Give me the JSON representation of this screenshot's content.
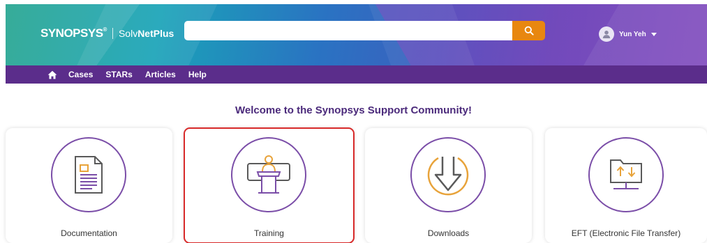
{
  "header": {
    "brand": "SYNOPSYS",
    "brand_mark": "®",
    "product_prefix": "Solv",
    "product_name": "NetPlus",
    "search": {
      "value": "",
      "placeholder": ""
    },
    "user": {
      "name": "Yun Yeh"
    }
  },
  "nav": {
    "items": [
      {
        "label": "Cases"
      },
      {
        "label": "STARs"
      },
      {
        "label": "Articles"
      },
      {
        "label": "Help"
      }
    ]
  },
  "main": {
    "welcome": "Welcome to the Synopsys Support Community!",
    "cards": [
      {
        "label": "Documentation",
        "icon": "document-icon",
        "selected": false
      },
      {
        "label": "Training",
        "icon": "presenter-podium-icon",
        "selected": true
      },
      {
        "label": "Downloads",
        "icon": "download-arrow-icon",
        "selected": false
      },
      {
        "label": "EFT (Electronic File Transfer)",
        "icon": "folder-transfer-icon",
        "selected": false
      }
    ]
  },
  "colors": {
    "nav_bg": "#5b2d8b",
    "search_button": "#e8870f",
    "accent_purple": "#7b4ea8",
    "icon_orange": "#e8a33a",
    "selection_outline": "#d82a2a"
  }
}
